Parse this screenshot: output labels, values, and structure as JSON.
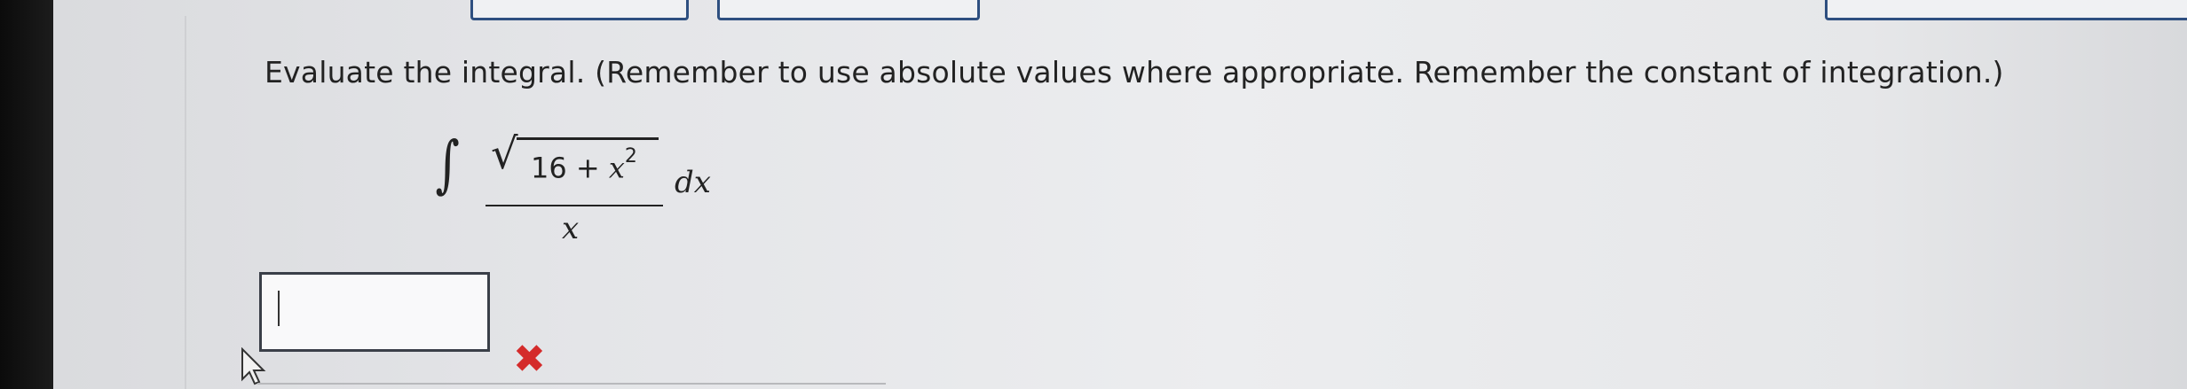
{
  "question": {
    "instruction": "Evaluate the integral. (Remember to use absolute values where appropriate. Remember the constant of integration.)"
  },
  "integral": {
    "symbol": "∫",
    "radicand_constant": "16 + ",
    "radicand_variable": "x",
    "radicand_exponent": "2",
    "denominator": "x",
    "differential": "dx"
  },
  "answer": {
    "value": "",
    "status": "incorrect",
    "status_icon": "close-icon",
    "status_glyph": "✖",
    "status_color": "#d42b2b"
  },
  "colors": {
    "button_border": "#2e4f80",
    "text": "#222222"
  }
}
